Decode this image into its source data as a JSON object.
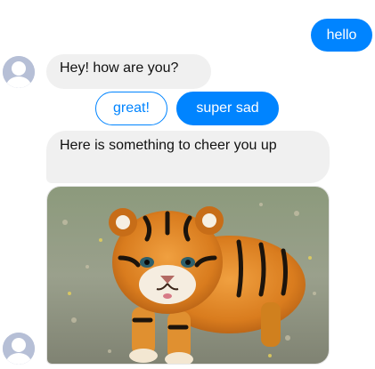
{
  "messages": {
    "outgoing_1": "hello",
    "incoming_1": "Hey! how are you?",
    "incoming_2": "Here is something to cheer you up"
  },
  "quick_replies": {
    "option_1": "great!",
    "option_2": "super sad"
  },
  "colors": {
    "accent": "#0084ff",
    "incoming_bubble": "#f0f0f0",
    "avatar": "#b6bfd6"
  },
  "icons": {
    "avatar": "default-user-avatar-icon"
  }
}
